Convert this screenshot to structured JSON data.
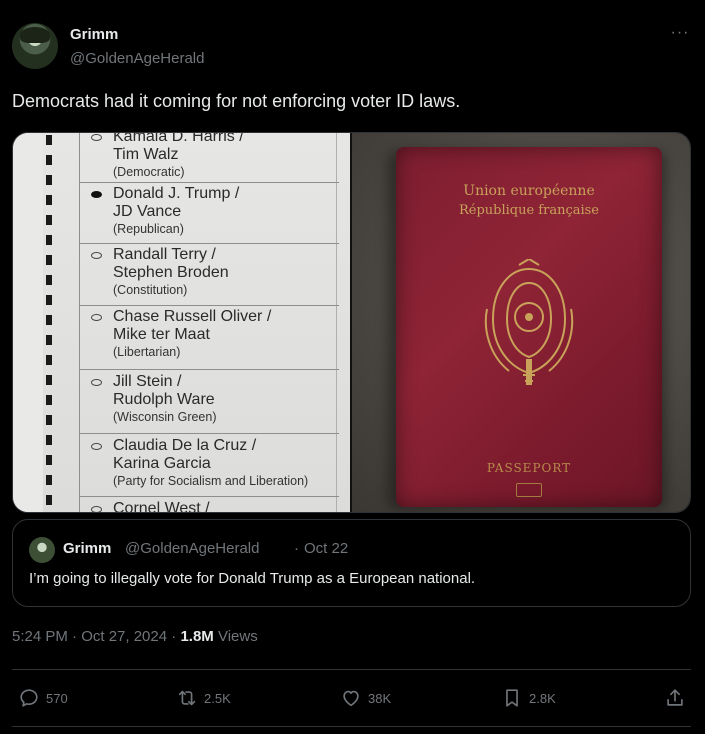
{
  "author": {
    "display_name": "Grimm",
    "handle": "@GoldenAgeHerald",
    "avatar_icon": "avatar"
  },
  "tweet": {
    "text": "Democrats had it coming for not enforcing voter ID laws.",
    "timestamp": "5:24 PM · Oct 27, 2024",
    "views_count": "1.8M",
    "views_label": "Views"
  },
  "media": {
    "ballot": {
      "candidates": [
        {
          "line1": "Kamala D. Harris /",
          "line2": "Tim Walz",
          "party": "(Democratic)",
          "selected": false
        },
        {
          "line1": "Donald J. Trump /",
          "line2": "JD Vance",
          "party": "(Republican)",
          "selected": true
        },
        {
          "line1": "Randall Terry /",
          "line2": "Stephen Broden",
          "party": "(Constitution)",
          "selected": false
        },
        {
          "line1": "Chase Russell Oliver /",
          "line2": "Mike ter Maat",
          "party": "(Libertarian)",
          "selected": false
        },
        {
          "line1": "Jill Stein /",
          "line2": "Rudolph Ware",
          "party": "(Wisconsin Green)",
          "selected": false
        },
        {
          "line1": "Claudia De la Cruz /",
          "line2": "Karina Garcia",
          "party": "(Party for Socialism and Liberation)",
          "selected": false
        },
        {
          "line1": "Cornel West /",
          "line2": "",
          "party": "",
          "selected": false
        }
      ]
    },
    "passport": {
      "line1": "Union européenne",
      "line2": "République française",
      "label": "PASSEPORT"
    }
  },
  "quote": {
    "display_name": "Grimm",
    "handle": "@GoldenAgeHerald",
    "separator": "·",
    "date": "Oct 22",
    "text": "I’m going to illegally vote for Donald Trump as a European national."
  },
  "actions": {
    "replies": "570",
    "reposts": "2.5K",
    "likes": "38K",
    "bookmarks": "2.8K"
  },
  "colors": {
    "background": "#000000",
    "text": "#e7e9ea",
    "muted": "#71767b",
    "border": "#2f3336"
  }
}
